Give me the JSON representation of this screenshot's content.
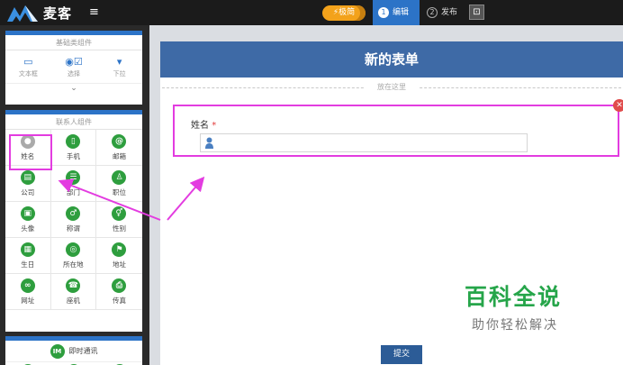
{
  "app": {
    "brand": "麦客",
    "menu_icon": "hamburger-icon",
    "speed_label": "⚡极简",
    "tabs": [
      {
        "step": "1",
        "label": "编辑",
        "active": true
      },
      {
        "step": "2",
        "label": "发布",
        "active": false
      }
    ],
    "preview_icon": "preview-icon"
  },
  "sidebar": {
    "basic": {
      "title": "基础类组件",
      "items": [
        {
          "label": "文本框",
          "icon": "textbox-icon",
          "glyph": "▭"
        },
        {
          "label": "选择",
          "icon": "choice-icon",
          "glyph": "◉☑"
        },
        {
          "label": "下拉",
          "icon": "dropdown-icon",
          "glyph": "▾"
        }
      ],
      "expand_icon": "chevron-down-icon"
    },
    "contact": {
      "title": "联系人组件",
      "items": [
        {
          "label": "姓名",
          "icon": "person-icon",
          "glyph": "●",
          "style": "grey"
        },
        {
          "label": "手机",
          "icon": "phone-icon",
          "glyph": "▯"
        },
        {
          "label": "邮箱",
          "icon": "email-icon",
          "glyph": "@"
        },
        {
          "label": "公司",
          "icon": "building-icon",
          "glyph": "▤"
        },
        {
          "label": "部门",
          "icon": "department-icon",
          "glyph": "☰"
        },
        {
          "label": "职位",
          "icon": "position-icon",
          "glyph": "♙"
        },
        {
          "label": "头像",
          "icon": "avatar-icon",
          "glyph": "▣"
        },
        {
          "label": "称谓",
          "icon": "title-icon",
          "glyph": "♂"
        },
        {
          "label": "性别",
          "icon": "gender-icon",
          "glyph": "⚥"
        },
        {
          "label": "生日",
          "icon": "birthday-icon",
          "glyph": "▦"
        },
        {
          "label": "所在地",
          "icon": "location-icon",
          "glyph": "◎"
        },
        {
          "label": "地址",
          "icon": "address-icon",
          "glyph": "⚑"
        },
        {
          "label": "网址",
          "icon": "link-icon",
          "glyph": "∞"
        },
        {
          "label": "座机",
          "icon": "telephone-icon",
          "glyph": "☎"
        },
        {
          "label": "传真",
          "icon": "fax-icon",
          "glyph": "⎙"
        }
      ]
    },
    "im": {
      "badge": "IM",
      "title": "即时通讯"
    }
  },
  "form": {
    "title": "新的表单",
    "drop_hint": "放在这里",
    "field_label": "姓名",
    "required_mark": "*",
    "input_icon": "person-icon",
    "input_value": "",
    "submit_label": "提交",
    "remove_icon": "close-icon",
    "remove_glyph": "✕"
  },
  "watermark": {
    "title": "百科全说",
    "subtitle": "助你轻松解决"
  },
  "colors": {
    "accent": "#2c73c7",
    "form_header": "#3e6aa6",
    "highlight": "#e33ce0",
    "icon_green": "#2e9e3e"
  }
}
